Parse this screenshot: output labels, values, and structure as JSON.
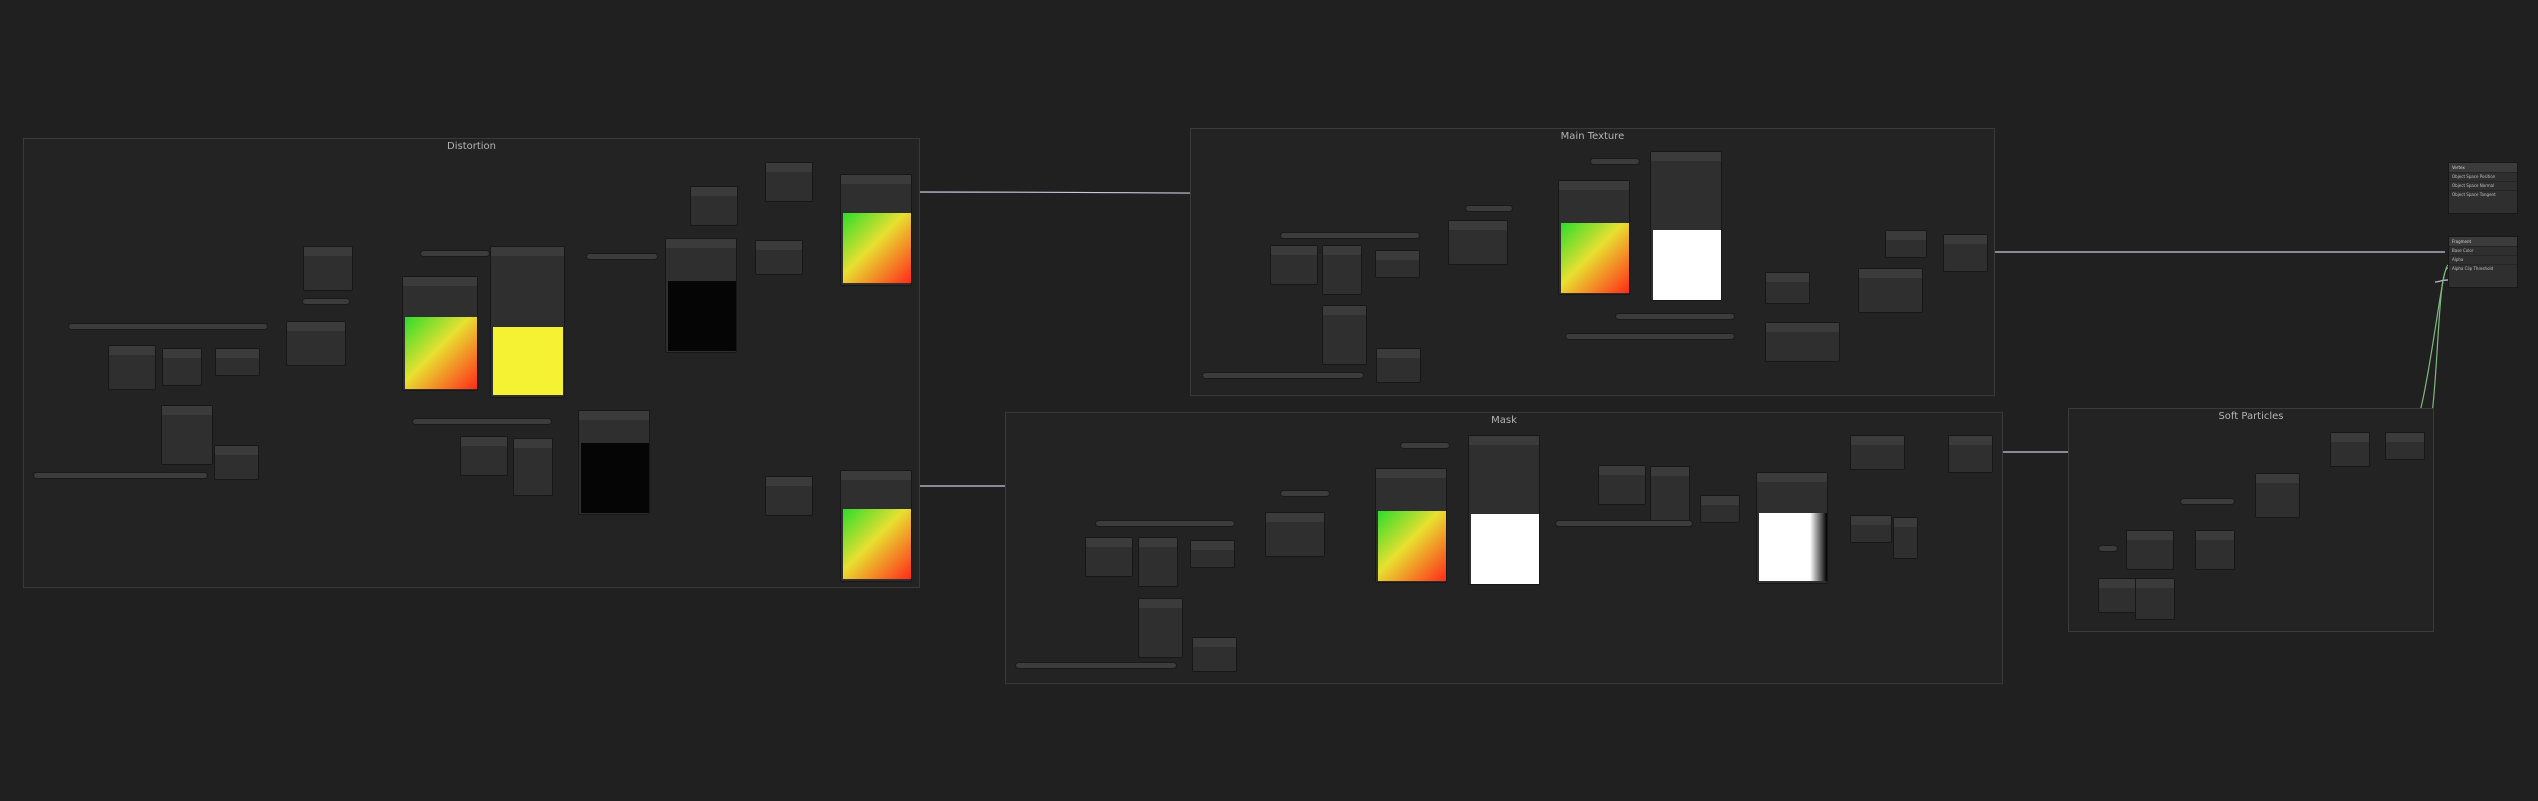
{
  "groups": {
    "distortion": "Distortion",
    "main_texture": "Main Texture",
    "mask": "Mask",
    "soft_particles": "Soft Particles"
  },
  "master": {
    "vertex_title": "Vertex",
    "vertex_rows": [
      "Object Space  Position",
      "Object Space  Normal",
      "Object Space  Tangent"
    ],
    "fragment_title": "Fragment",
    "fragment_rows": [
      "Base Color",
      "Alpha",
      "Alpha Clip Threshold"
    ]
  },
  "colors": {
    "background": "#202020",
    "wire_float": "#7fb97f",
    "wire_vector": "#c8c8e0",
    "wire_color": "#d8a8d8"
  }
}
